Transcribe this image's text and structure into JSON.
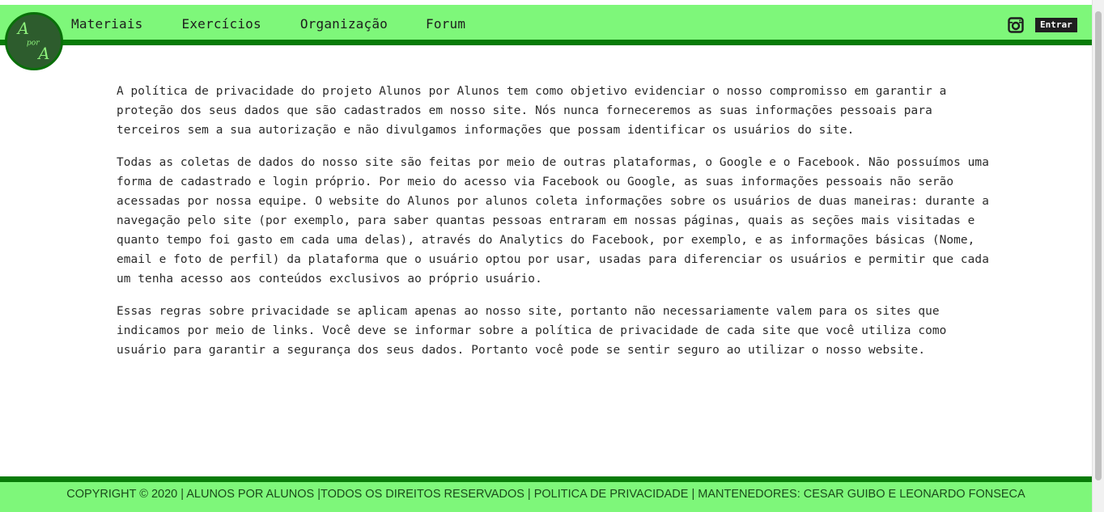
{
  "colors": {
    "nav_bg": "#7ef77a",
    "nav_border": "#087b08",
    "logo_bg": "#2d5c2d",
    "logo_text": "#8ef27c",
    "button_bg": "#1f1f1f",
    "text": "#2a2a2a"
  },
  "logo": {
    "text_top": "A",
    "text_middle": "por",
    "text_bottom": "A"
  },
  "nav": {
    "items": [
      {
        "label": "Materiais"
      },
      {
        "label": "Exercícios"
      },
      {
        "label": "Organização"
      },
      {
        "label": "Forum"
      }
    ],
    "instagram_icon": "instagram-icon",
    "login_label": "Entrar"
  },
  "content": {
    "paragraphs": [
      "A política de privacidade do projeto Alunos por Alunos tem como objetivo evidenciar o nosso compromisso em garantir a proteção dos seus dados que são cadastrados em nosso site. Nós nunca forneceremos as suas informações pessoais para terceiros sem a sua autorização e não divulgamos informações que possam identificar os usuários do site.",
      "Todas as coletas de dados do nosso site são feitas por meio de outras plataformas, o Google e o Facebook. Não possuímos uma forma de cadastrado e login próprio. Por meio do acesso via Facebook ou Google, as suas informações pessoais não serão acessadas por nossa equipe. O website do Alunos por alunos coleta informações sobre os usuários de duas maneiras: durante a navegação pelo site (por exemplo, para saber quantas pessoas entraram em nossas páginas, quais as seções mais visitadas e quanto tempo foi gasto em cada uma delas), através do Analytics do Facebook, por exemplo, e as informações básicas (Nome, email e foto de perfil) da plataforma que o usuário optou por usar, usadas para diferenciar os usuários e permitir que cada um tenha acesso aos conteúdos exclusivos ao próprio usuário.",
      "Essas regras sobre privacidade se aplicam apenas ao nosso site, portanto não necessariamente valem para os sites que indicamos por meio de links. Você deve se informar sobre a política de privacidade de cada site que você utiliza como usuário para garantir a segurança dos seus dados. Portanto você pode se sentir seguro ao utilizar o nosso website."
    ]
  },
  "footer": {
    "text": "COPYRIGHT © 2020 | ALUNOS POR ALUNOS |TODOS OS DIREITOS RESERVADOS | POLITICA DE PRIVACIDADE | MANTENEDORES: CESAR GUIBO E LEONARDO FONSECA"
  }
}
